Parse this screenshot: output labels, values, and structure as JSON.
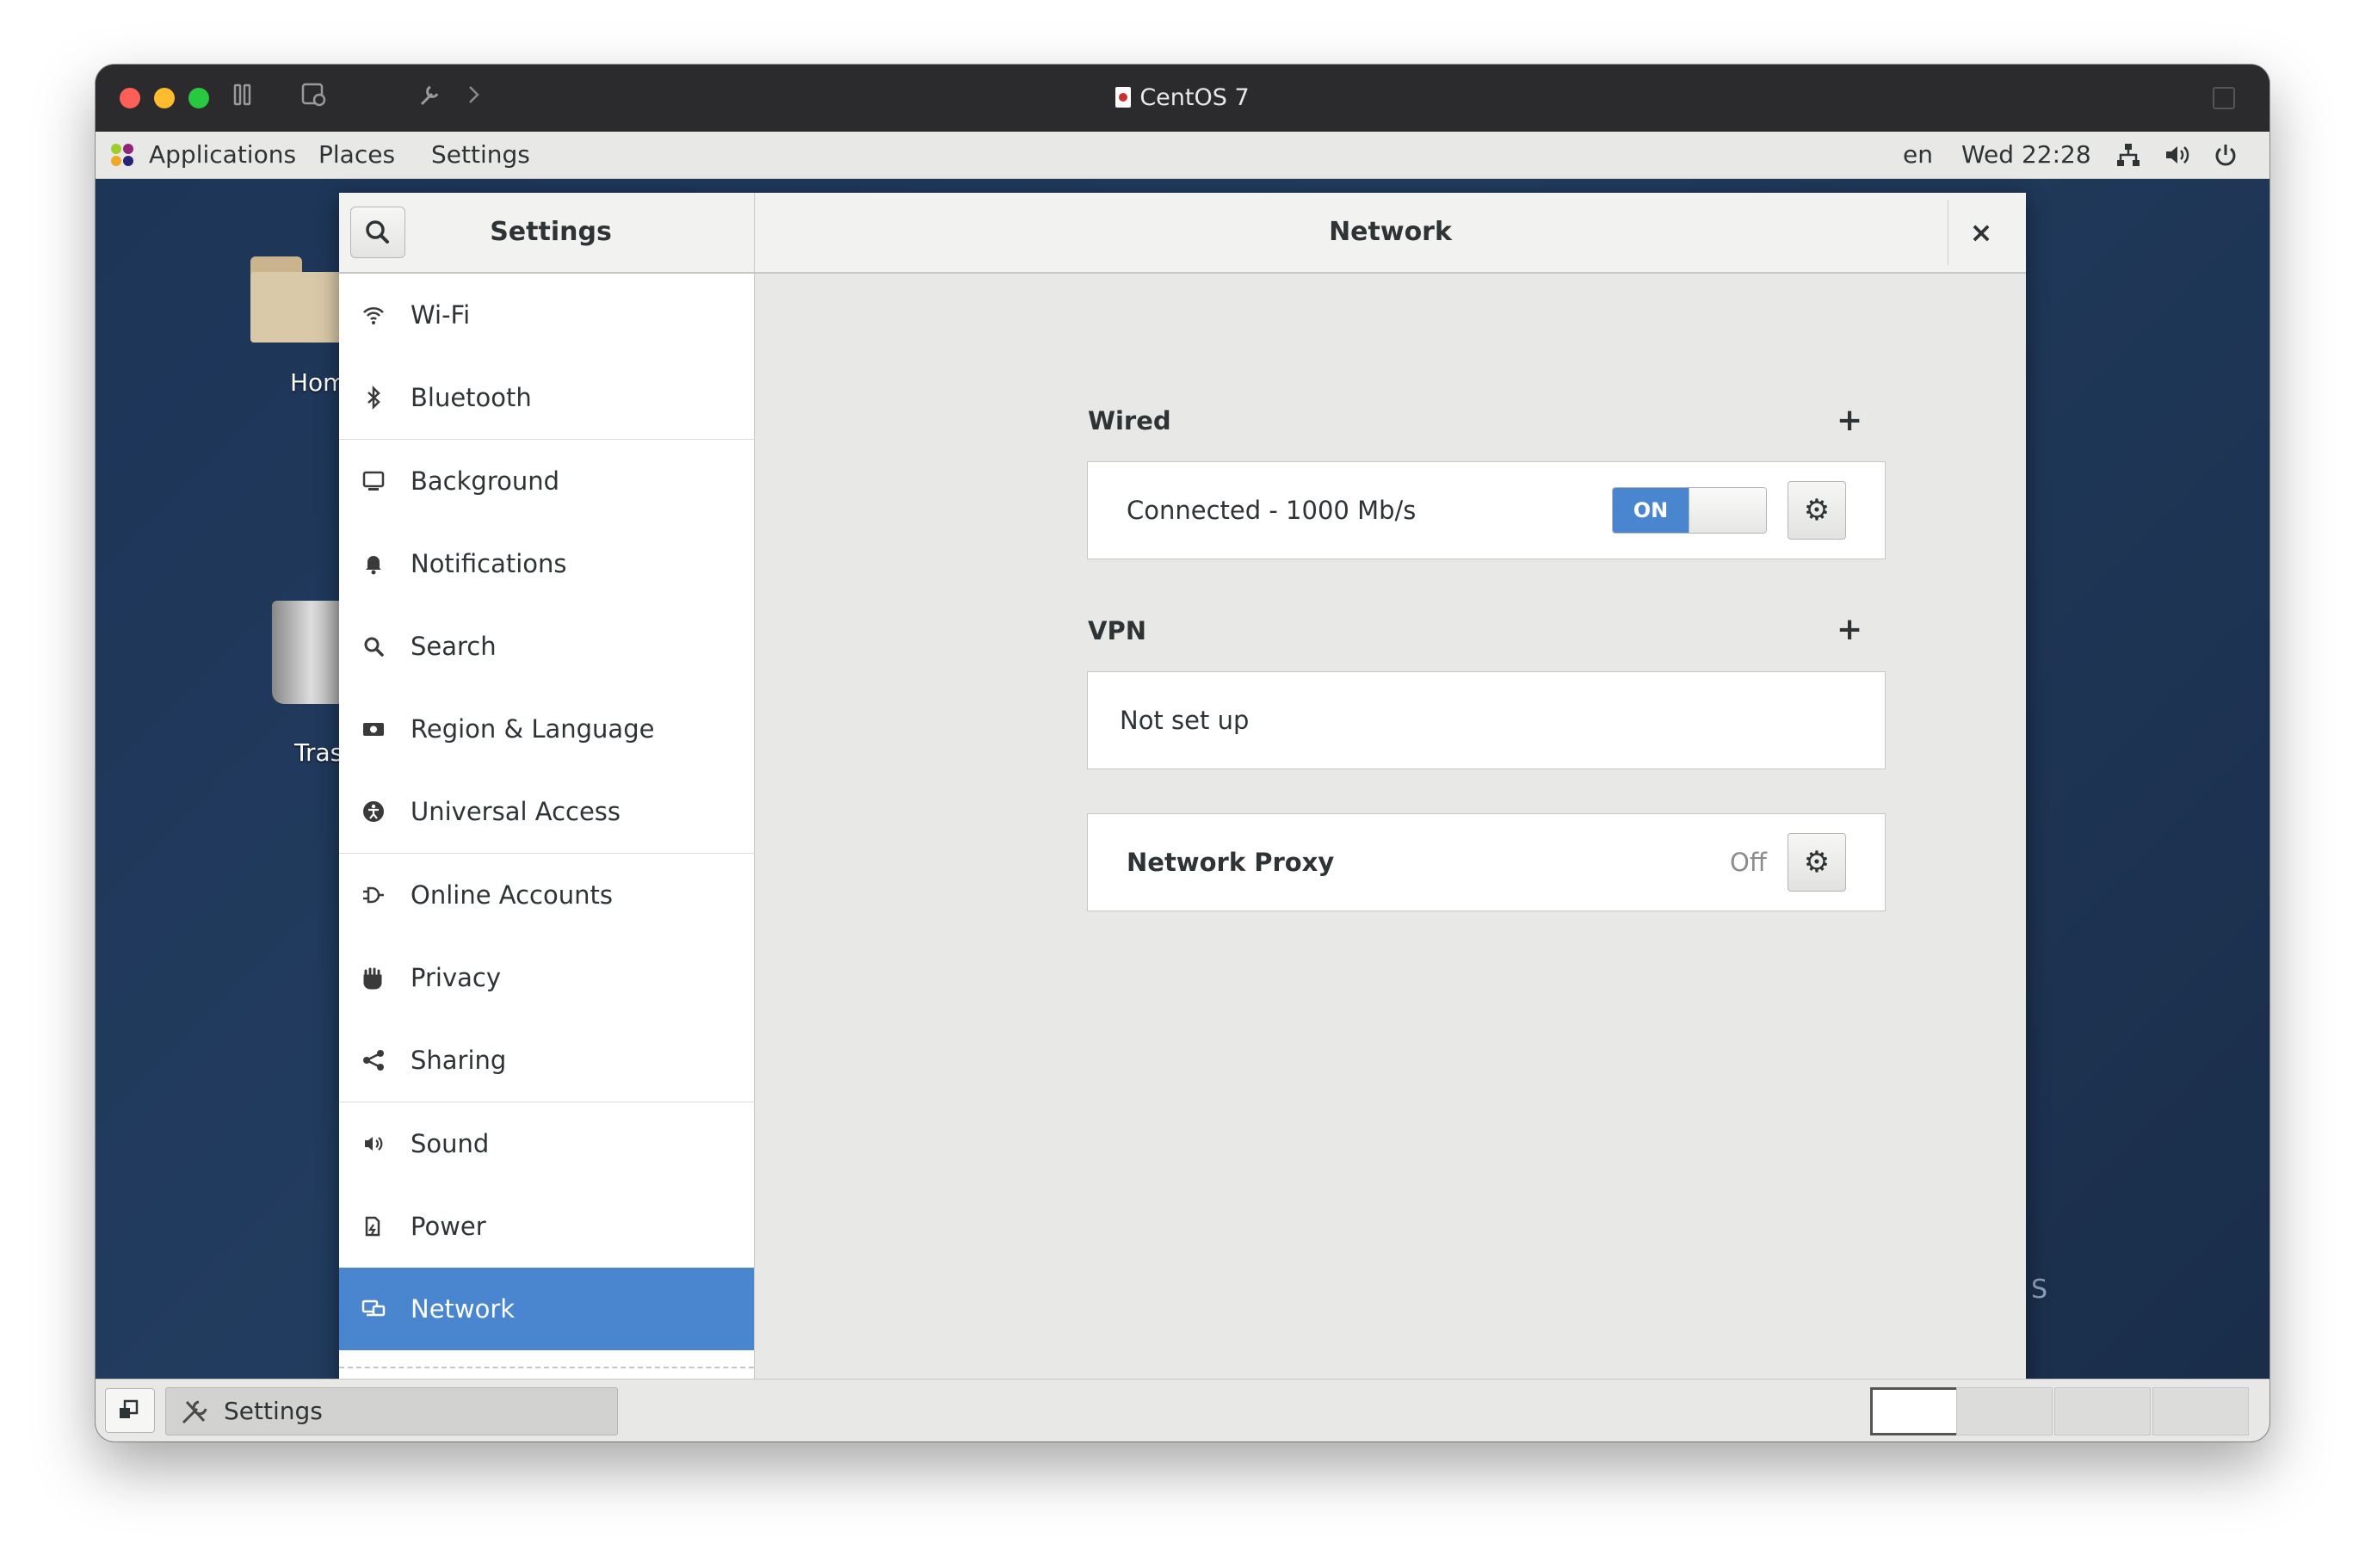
{
  "vm": {
    "title": "CentOS 7"
  },
  "topbar": {
    "menus": [
      "Applications",
      "Places",
      "Settings"
    ],
    "lang": "en",
    "clock": "Wed 22:28"
  },
  "desktop": {
    "home_label": "Hom",
    "trash_label": "Tras",
    "corner_text": "S"
  },
  "settings": {
    "sidebar_title": "Settings",
    "panel_title": "Network",
    "close_glyph": "×",
    "sidebar_items": [
      {
        "label": "Wi-Fi",
        "icon": "wifi-icon"
      },
      {
        "label": "Bluetooth",
        "icon": "bluetooth-icon"
      },
      {
        "label": "Background",
        "icon": "background-icon"
      },
      {
        "label": "Notifications",
        "icon": "bell-icon"
      },
      {
        "label": "Search",
        "icon": "search-icon"
      },
      {
        "label": "Region & Language",
        "icon": "region-icon"
      },
      {
        "label": "Universal Access",
        "icon": "accessibility-icon"
      },
      {
        "label": "Online Accounts",
        "icon": "online-accounts-icon"
      },
      {
        "label": "Privacy",
        "icon": "hand-icon"
      },
      {
        "label": "Sharing",
        "icon": "share-icon"
      },
      {
        "label": "Sound",
        "icon": "speaker-icon"
      },
      {
        "label": "Power",
        "icon": "power-plug-icon"
      },
      {
        "label": "Network",
        "icon": "network-icon",
        "selected": true
      }
    ],
    "network": {
      "wired": {
        "heading": "Wired",
        "add_glyph": "+",
        "status": "Connected - 1000 Mb/s",
        "toggle_label": "ON",
        "toggle_on": true
      },
      "vpn": {
        "heading": "VPN",
        "add_glyph": "+",
        "status": "Not set up"
      },
      "proxy": {
        "label": "Network Proxy",
        "status": "Off"
      }
    }
  },
  "taskbar": {
    "task_label": "Settings"
  },
  "colors": {
    "accent": "#4a86cf",
    "panel_bg": "#e8e8e7",
    "desktop_bg": "#1d3557"
  }
}
